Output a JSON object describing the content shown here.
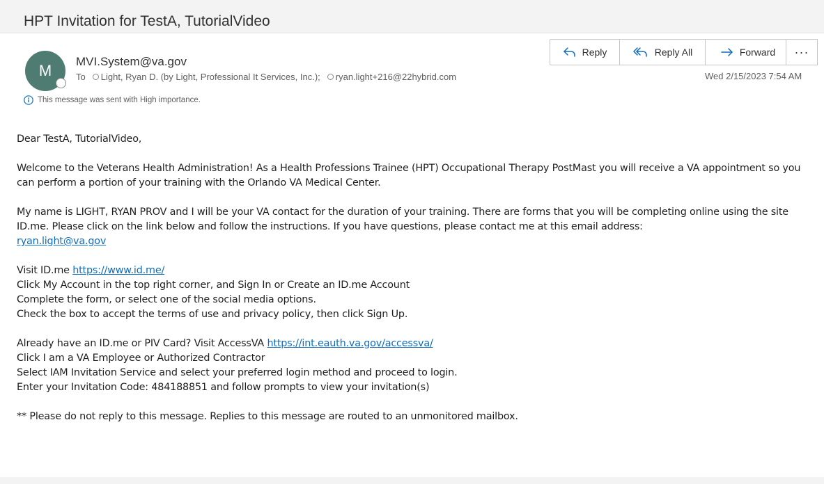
{
  "email": {
    "subject": "HPT Invitation for TestA, TutorialVideo",
    "avatar_initial": "M",
    "sender": "MVI.System@va.gov",
    "to_label": "To",
    "recipients": [
      "Light, Ryan D. (by Light, Professional It Services, Inc.);",
      "ryan.light+216@22hybrid.com"
    ],
    "importance_note": "This message was sent with High importance.",
    "date": "Wed 2/15/2023 7:54 AM"
  },
  "actions": {
    "reply": "Reply",
    "reply_all": "Reply All",
    "forward": "Forward",
    "more": "···"
  },
  "body": {
    "greeting": "Dear TestA, TutorialVideo,",
    "para1": "Welcome to the Veterans Health Administration! As a Health Professions Trainee (HPT) Occupational Therapy PostMast you will receive a VA appointment so you can perform a portion of your training with the Orlando VA Medical Center.",
    "para2": "My name is LIGHT, RYAN PROV and I will be your VA contact for the duration of your training. There are forms that you will be completing online using the site ID.me. Please click on the link below and follow the instructions. If you have questions, please contact me at this email address:",
    "contact_email": "ryan.light@va.gov",
    "idme_prefix": "Visit ID.me",
    "idme_link": "https://www.id.me/",
    "idme_step1": "Click My Account in the top right corner, and Sign In or Create an ID.me Account",
    "idme_step2": "Complete the form, or select one of the social media options.",
    "idme_step3": "Check the box to accept the terms of use and privacy policy, then click Sign Up.",
    "accessva_prefix": "Already have an ID.me or PIV Card? Visit AccessVA",
    "accessva_link": "https://int.eauth.va.gov/accessva/",
    "accessva_step1": "Click I am a VA Employee or Authorized Contractor",
    "accessva_step2": "Select IAM Invitation Service and select your preferred login method and proceed to login.",
    "accessva_step3": "Enter your Invitation Code: 484188851 and follow prompts to view your invitation(s)",
    "footer_note": "** Please do not reply to this message. Replies to this message are routed to an unmonitored mailbox."
  },
  "colors": {
    "link": "#0f6cbd",
    "avatar_bg": "#4f7c72",
    "header_bg": "#f3f3f3",
    "info_icon": "#0f6cbd"
  },
  "icons": [
    "reply-icon",
    "reply-all-icon",
    "forward-icon",
    "more-icon",
    "info-icon",
    "presence-icon"
  ]
}
